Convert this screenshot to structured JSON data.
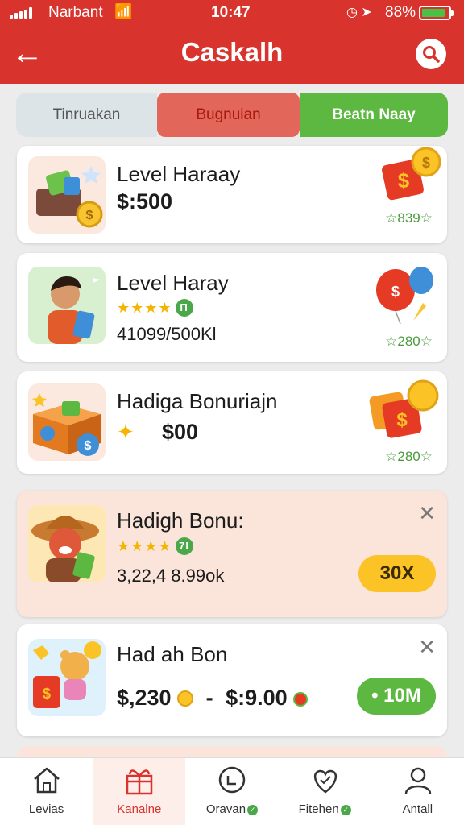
{
  "status_bar": {
    "carrier": "Narbant",
    "time": "10:47",
    "battery_pct": "88%",
    "battery_level": 0.88,
    "icons": [
      "signal-icon",
      "wifi-icon",
      "alarm-icon",
      "location-icon",
      "battery-icon"
    ]
  },
  "header": {
    "title": "Caskalh",
    "back_icon": "back-arrow-icon",
    "search_icon": "search-icon",
    "accent": "#d8332c"
  },
  "tabs": [
    {
      "label": "Tinruakan",
      "color": "#dde4e8"
    },
    {
      "label": "Bugnuian",
      "color": "#e26659"
    },
    {
      "label": "Beatn Naay",
      "color": "#5cb840"
    }
  ],
  "cards": [
    {
      "title": "Level Haraay",
      "amount": "$:500",
      "reward_meta": "☆839☆",
      "thumb_icon": "wallet-coins-icon",
      "reward_icon": "red-envelope-coin-icon"
    },
    {
      "title": "Level Haray",
      "rating": 4,
      "rating_badge": "Π",
      "progress": "41099/500Kl",
      "reward_meta": "☆280☆",
      "thumb_icon": "boy-phone-icon",
      "reward_icon": "balloons-icon"
    },
    {
      "title": "Hadiga Bonuriajn",
      "amount_prefix_icon": "sparkle-star-icon",
      "amount": "$00",
      "reward_meta": "☆280☆",
      "thumb_icon": "gift-box-icon",
      "reward_icon": "red-envelope-coin-icon"
    },
    {
      "title": "Hadigh Bonu:",
      "rating": 3.5,
      "rating_badge": "7I",
      "progress": "3,22,4 8.99ok",
      "button_label": "30X",
      "thumb_icon": "character-money-icon",
      "close_icon": "close-icon"
    },
    {
      "title": "Had ah Bon",
      "amount": "$,230",
      "amount_sep": "-",
      "amount_to": "$:9.00",
      "button_label": "• 10M",
      "thumb_icon": "bear-shopping-icon",
      "close_icon": "close-icon"
    }
  ],
  "bottom_nav": [
    {
      "label": "Levias",
      "icon": "home-icon",
      "active": false
    },
    {
      "label": "Kanalne",
      "icon": "gift-icon",
      "active": true
    },
    {
      "label": "Oravan",
      "icon": "chat-icon",
      "active": false,
      "verified": true
    },
    {
      "label": "Fitehen",
      "icon": "heart-icon",
      "active": false,
      "verified": true
    },
    {
      "label": "Antall",
      "icon": "profile-icon",
      "active": false
    }
  ],
  "colors": {
    "brand_red": "#d8332c",
    "green": "#5cb840",
    "yellow": "#fbc326",
    "star": "#f4b400"
  }
}
